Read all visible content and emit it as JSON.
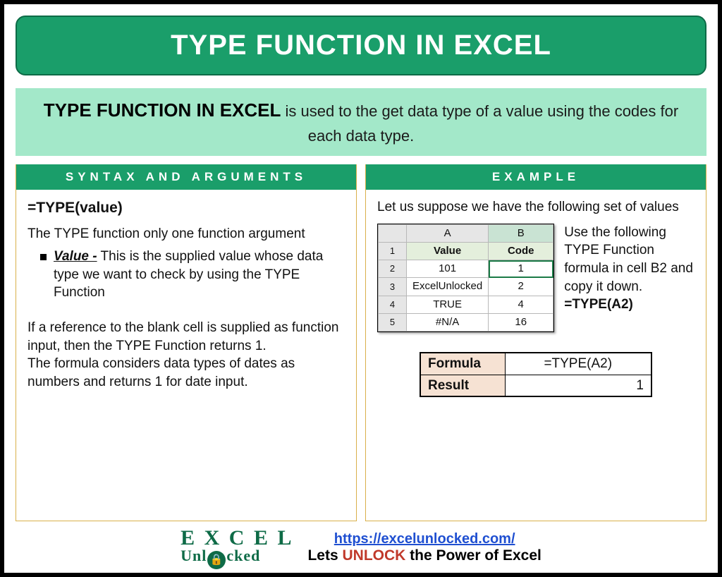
{
  "title": "TYPE FUNCTION IN EXCEL",
  "intro": {
    "lead": "TYPE FUNCTION IN EXCEL",
    "rest": " is used to the get data type of a value using the codes for each data type."
  },
  "left": {
    "header": "SYNTAX AND ARGUMENTS",
    "syntax": "=TYPE(value)",
    "desc1": "The TYPE function only one function argument",
    "arg_name": "Value -",
    "arg_desc": " This is the supplied value whose data type we want to check by using the TYPE Function",
    "note1": "If a reference to the blank cell is supplied as function input, then the TYPE Function returns 1.",
    "note2": "The formula considers data types of dates as numbers and returns 1 for date input."
  },
  "right": {
    "header": "EXAMPLE",
    "intro": "Let us suppose we have the following set of values",
    "sheet": {
      "colA": "A",
      "colB": "B",
      "headers": {
        "value": "Value",
        "code": "Code"
      },
      "rows": [
        {
          "n": "1"
        },
        {
          "n": "2",
          "a": "101",
          "b": "1"
        },
        {
          "n": "3",
          "a": "ExcelUnlocked",
          "b": "2"
        },
        {
          "n": "4",
          "a": "TRUE",
          "b": "4"
        },
        {
          "n": "5",
          "a": "#N/A",
          "b": "16"
        }
      ]
    },
    "note": "Use the following TYPE Function formula in cell B2 and copy it down.",
    "note_formula": "=TYPE(A2)",
    "result": {
      "formula_label": "Formula",
      "formula_value": "=TYPE(A2)",
      "result_label": "Result",
      "result_value": "1"
    }
  },
  "footer": {
    "logo_top": "E X C E L",
    "logo_bottom_pre": "Unl",
    "logo_bottom_post": "cked",
    "url": "https://excelunlocked.com/",
    "tag_pre": "Lets ",
    "tag_mid": "UNLOCK",
    "tag_post": " the Power of Excel"
  }
}
